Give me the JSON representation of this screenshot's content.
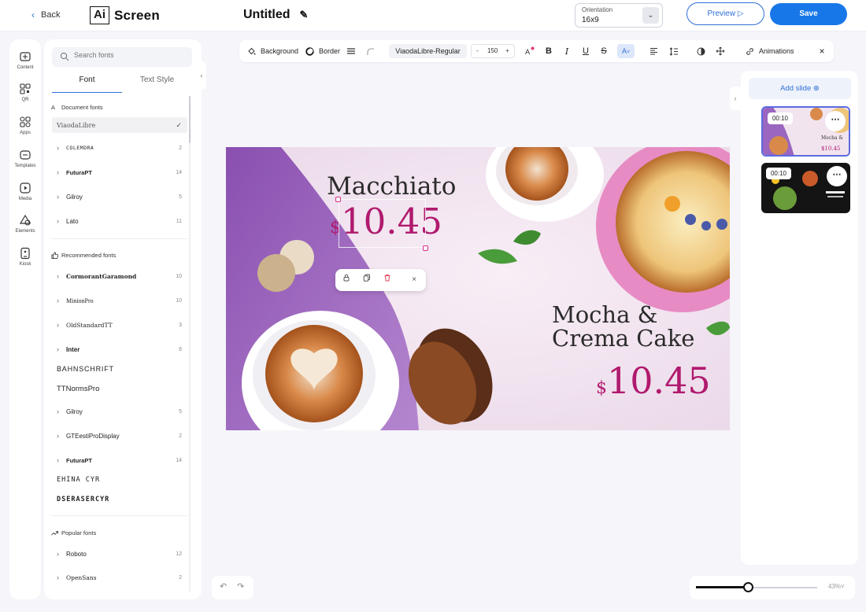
{
  "header": {
    "back_label": "Back",
    "logo_mark": "Ai",
    "logo_word": "Screen",
    "doc_title": "Untitled",
    "orientation_label": "Orientation",
    "orientation_value": "16x9",
    "preview_label": "Preview",
    "save_label": "Save"
  },
  "rail": [
    {
      "label": "Content",
      "icon": "content-icon"
    },
    {
      "label": "QR",
      "icon": "qr-icon"
    },
    {
      "label": "Apps",
      "icon": "apps-icon"
    },
    {
      "label": "Templates",
      "icon": "templates-icon"
    },
    {
      "label": "Media",
      "icon": "media-icon"
    },
    {
      "label": "Elements",
      "icon": "elements-icon"
    },
    {
      "label": "Kiosk",
      "icon": "kiosk-icon"
    }
  ],
  "font_panel": {
    "search_placeholder": "Search fonts",
    "tab_font": "Font",
    "tab_text_style": "Text Style",
    "document_fonts_title": "Document fonts",
    "document_fonts": [
      {
        "name": "ViaodaLibre",
        "selected": true
      },
      {
        "name": "COLEMDRA",
        "count": "2"
      },
      {
        "name": "FuturaPT",
        "count": "14"
      },
      {
        "name": "Gilroy",
        "count": "5"
      },
      {
        "name": "Lato",
        "count": "11"
      }
    ],
    "recommended_title": "Recommended fonts",
    "recommended_fonts": [
      {
        "name": "CormorantGaramond",
        "count": "10",
        "expandable": true
      },
      {
        "name": "MinionPro",
        "count": "10",
        "expandable": true
      },
      {
        "name": "OldStandardTT",
        "count": "3",
        "expandable": true
      },
      {
        "name": "Inter",
        "count": "6",
        "expandable": true
      },
      {
        "name": "BAHNSCHRIFT",
        "expandable": false
      },
      {
        "name": "TTNormsPro",
        "expandable": false
      },
      {
        "name": "Gilroy",
        "count": "5",
        "expandable": true
      },
      {
        "name": "GTEestiProDisplay",
        "count": "2",
        "expandable": true
      },
      {
        "name": "FuturaPT",
        "count": "14",
        "expandable": true
      },
      {
        "name": "EHINA CYR",
        "expandable": false
      },
      {
        "name": "DSERASERCYR",
        "expandable": false
      }
    ],
    "popular_title": "Popular fonts",
    "popular_fonts": [
      {
        "name": "Roboto",
        "count": "12"
      },
      {
        "name": "OpenSans",
        "count": "2"
      }
    ]
  },
  "toolbar": {
    "background_label": "Background",
    "border_label": "Border",
    "font_name": "ViaodaLibre-Regular",
    "font_size": "150",
    "minus": "-",
    "plus": "+",
    "bold": "B",
    "italic": "I",
    "underline": "U",
    "strike": "S",
    "text_effect": "A",
    "animations_label": "Animations",
    "close": "×"
  },
  "canvas": {
    "macchiato": "Macchiato",
    "price1_currency": "$",
    "price1": "10.45",
    "mocha_line1": "Mocha &",
    "mocha_line2": "Crema Cake",
    "price2_currency": "$",
    "price2": "10.45",
    "context_close": "×"
  },
  "slides": {
    "add_label": "Add slide",
    "items": [
      {
        "time": "00:10",
        "active": true
      },
      {
        "time": "00:10",
        "active": false
      }
    ]
  },
  "zoom": {
    "value": "43%",
    "level": 0.43
  },
  "colors": {
    "accent": "#1877e8",
    "price": "#b01a6e",
    "handle": "#d62e8a"
  }
}
